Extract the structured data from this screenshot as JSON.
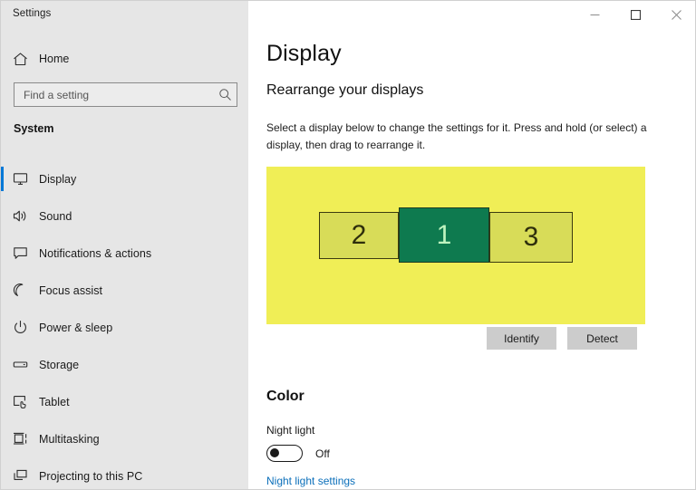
{
  "window": {
    "title": "Settings",
    "controls": [
      {
        "name": "minimize",
        "label": "Minimize"
      },
      {
        "name": "maximize",
        "label": "Maximize"
      },
      {
        "name": "close",
        "label": "Close"
      }
    ]
  },
  "sidebar": {
    "home_label": "Home",
    "home_icon": "home-icon",
    "search": {
      "placeholder": "Find a setting",
      "value": "",
      "icon": "search-icon"
    },
    "group_header": "System",
    "items": [
      {
        "label": "Display",
        "icon": "monitor-icon",
        "selected": true
      },
      {
        "label": "Sound",
        "icon": "speaker-icon",
        "selected": false
      },
      {
        "label": "Notifications & actions",
        "icon": "notification-icon",
        "selected": false
      },
      {
        "label": "Focus assist",
        "icon": "moon-icon",
        "selected": false
      },
      {
        "label": "Power & sleep",
        "icon": "power-icon",
        "selected": false
      },
      {
        "label": "Storage",
        "icon": "drive-icon",
        "selected": false
      },
      {
        "label": "Tablet",
        "icon": "tablet-icon",
        "selected": false
      },
      {
        "label": "Multitasking",
        "icon": "multitasking-icon",
        "selected": false
      },
      {
        "label": "Projecting to this PC",
        "icon": "projecting-icon",
        "selected": false
      }
    ]
  },
  "main": {
    "page_title": "Display",
    "rearrange": {
      "heading": "Rearrange your displays",
      "description": "Select a display below to change the settings for it. Press and hold (or select) a display, then drag to rearrange it.",
      "displays": [
        {
          "number": "2",
          "selected": false
        },
        {
          "number": "1",
          "selected": true
        },
        {
          "number": "3",
          "selected": false
        }
      ],
      "identify_button": "Identify",
      "detect_button": "Detect"
    },
    "color": {
      "heading": "Color",
      "night_light_label": "Night light",
      "night_light_state": "Off",
      "night_light_on": false,
      "settings_link": "Night light settings"
    }
  },
  "colors": {
    "accent": "#0078d7",
    "link": "#0b6fba",
    "canvas_yellow": "#f0ee56",
    "display_unselected": "#d8dc58",
    "display_selected": "#0e7a4f",
    "display_selected_text": "#bff4c0",
    "sidebar_bg": "#e6e6e6",
    "button_bg": "#cccccc"
  }
}
